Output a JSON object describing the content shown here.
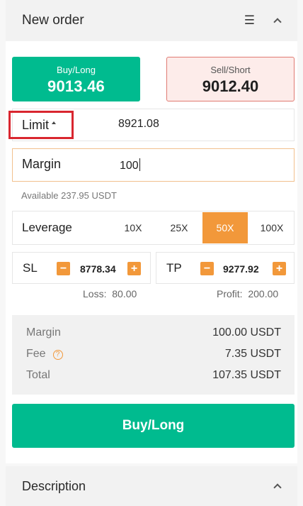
{
  "header": {
    "title": "New order",
    "menu_icon": "menu-icon",
    "collapse_icon": "chevron-up-icon"
  },
  "buy": {
    "label": "Buy/Long",
    "price": "9013.46"
  },
  "sell": {
    "label": "Sell/Short",
    "price": "9012.40"
  },
  "order_type": {
    "label": "Limit",
    "value": "8921.08"
  },
  "margin": {
    "label": "Margin",
    "value": "100"
  },
  "available": "Available 237.95 USDT",
  "leverage": {
    "label": "Leverage",
    "options": [
      "10X",
      "25X",
      "50X",
      "100X"
    ],
    "selected": "50X"
  },
  "sl": {
    "label": "SL",
    "value": "8778.34",
    "minus": "−",
    "plus": "+",
    "loss_label": "Loss:",
    "loss_value": "80.00"
  },
  "tp": {
    "label": "TP",
    "value": "9277.92",
    "minus": "−",
    "plus": "+",
    "profit_label": "Profit:",
    "profit_value": "200.00"
  },
  "summary": {
    "margin_label": "Margin",
    "margin_value": "100.00 USDT",
    "fee_label": "Fee",
    "fee_info": "?",
    "fee_value": "7.35 USDT",
    "total_label": "Total",
    "total_value": "107.35 USDT"
  },
  "submit": {
    "label": "Buy/Long"
  },
  "description": {
    "title": "Description"
  },
  "colors": {
    "buy_green": "#00bb8f",
    "sell_red_border": "#e07a72",
    "accent_orange": "#f2983a",
    "highlight_red": "#d9262f"
  }
}
